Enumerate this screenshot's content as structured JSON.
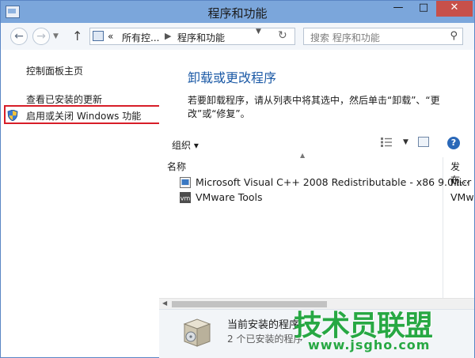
{
  "window": {
    "title": "程序和功能",
    "minimize": "—",
    "maximize": "□",
    "close": "✕"
  },
  "nav": {
    "back": "←",
    "forward": "→",
    "up": "↑",
    "breadcrumb": [
      "«",
      "所有控...",
      "程序和功能"
    ],
    "search_placeholder": "搜索 程序和功能"
  },
  "sidebar": {
    "items": [
      {
        "label": "控制面板主页"
      },
      {
        "label": "查看已安装的更新"
      },
      {
        "label": "启用或关闭 Windows 功能"
      }
    ]
  },
  "main": {
    "heading": "卸载或更改程序",
    "description": "若要卸载程序，请从列表中将其选中，然后单击“卸载”、“更改”或“修复”。",
    "toolbar": {
      "organize": "组织 ▾"
    },
    "columns": {
      "name": "名称",
      "publisher": "发布..."
    },
    "programs": [
      {
        "name": "Microsoft Visual C++ 2008 Redistributable - x86 9.0...",
        "publisher": "Micr"
      },
      {
        "name": "VMware Tools",
        "publisher": "VMw"
      }
    ]
  },
  "details": {
    "title": "当前安装的程序",
    "count": "2 个已安装的程序"
  },
  "watermark": {
    "brand": "技术员联盟",
    "url": "www.jsgho.com"
  }
}
